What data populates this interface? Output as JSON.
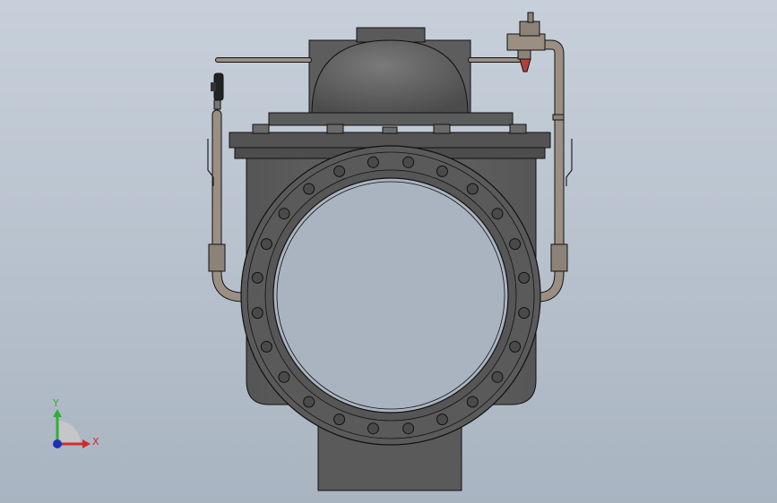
{
  "viewport": {
    "background_top": "#c7d0da",
    "background_bottom": "#a9b4c1"
  },
  "colors": {
    "body": "#5f5f5f",
    "body_dark": "#4e4e4e",
    "body_light": "#707070",
    "outline": "#111111",
    "pipe": "#9b8f84",
    "pipe_dark": "#6f655d",
    "bore": "#aab4c0",
    "accent_red": "#b0413e"
  },
  "triad": {
    "y_label": "Y",
    "x_label": "X",
    "y_color": "#2db034",
    "x_color": "#d12b2b",
    "z_color": "#1f2fb8"
  }
}
